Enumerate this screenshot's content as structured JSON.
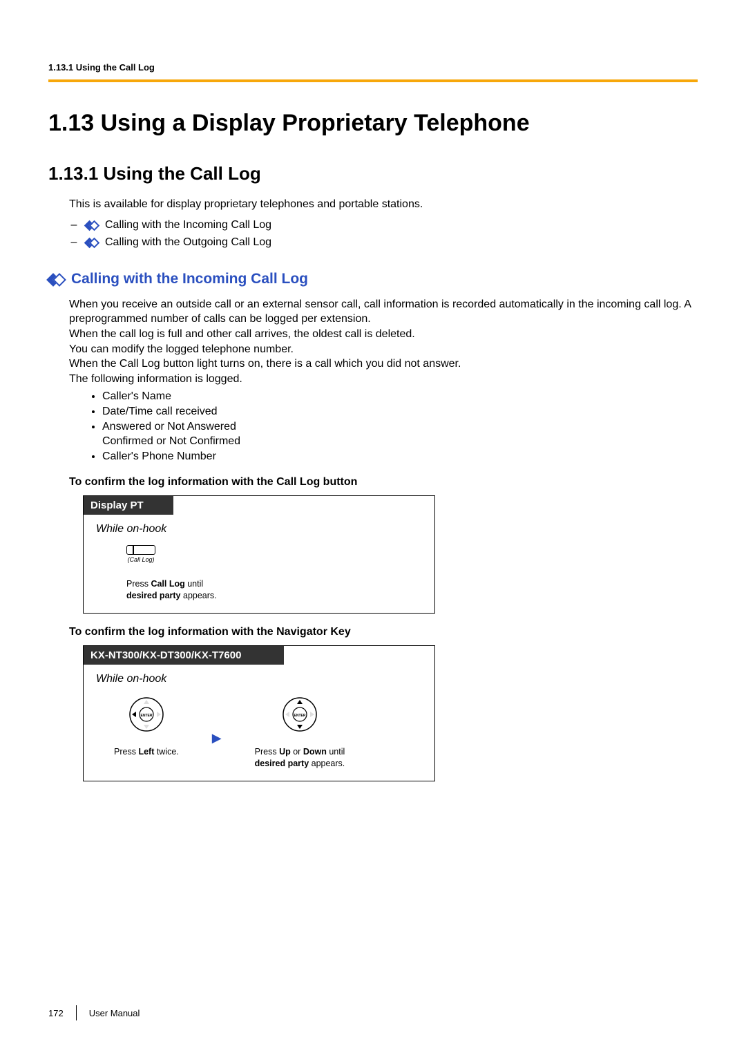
{
  "runningHead": "1.13.1 Using the Call Log",
  "chapterTitle": "1.13  Using a Display Proprietary Telephone",
  "sectionTitle": "1.13.1  Using the Call Log",
  "intro": "This is available for display proprietary telephones and portable stations.",
  "dashItems": [
    "Calling with the Incoming Call Log",
    "Calling with the Outgoing Call Log"
  ],
  "subHead": "Calling with the Incoming Call Log",
  "para1": "When you receive an outside call or an external sensor call, call information is recorded automatically in the incoming call log. A preprogrammed number of calls can be logged per extension.",
  "para2": "When the call log is full and other call arrives, the oldest call is deleted.",
  "para3": "You can modify the logged telephone number.",
  "para4": "When the Call Log button light turns on, there is a call which you did not answer.",
  "para5": "The following information is logged.",
  "bullets": [
    "Caller's Name",
    "Date/Time call received",
    "Answered or Not Answered\nConfirmed or Not Confirmed",
    "Caller's Phone Number"
  ],
  "proc1": {
    "heading": "To confirm the log information with the Call Log button",
    "boxTitle": "Display PT",
    "state": "While on-hook",
    "keyLabel": "(Call Log)",
    "instrPre": "Press ",
    "instrB1": "Call Log",
    "instrMid": " until",
    "instrB2": "desired party",
    "instrPost": " appears."
  },
  "proc2": {
    "heading": "To confirm the log information with the Navigator Key",
    "boxTitle": "KX-NT300/KX-DT300/KX-T7600",
    "state": "While on-hook",
    "col1": {
      "pre": "Press ",
      "b1": "Left",
      "post": " twice."
    },
    "col2": {
      "pre": "Press ",
      "b1": "Up",
      "mid": " or ",
      "b2": "Down",
      "mid2": " until",
      "b3": "desired party",
      "post": " appears."
    }
  },
  "footer": {
    "page": "172",
    "label": "User Manual"
  }
}
